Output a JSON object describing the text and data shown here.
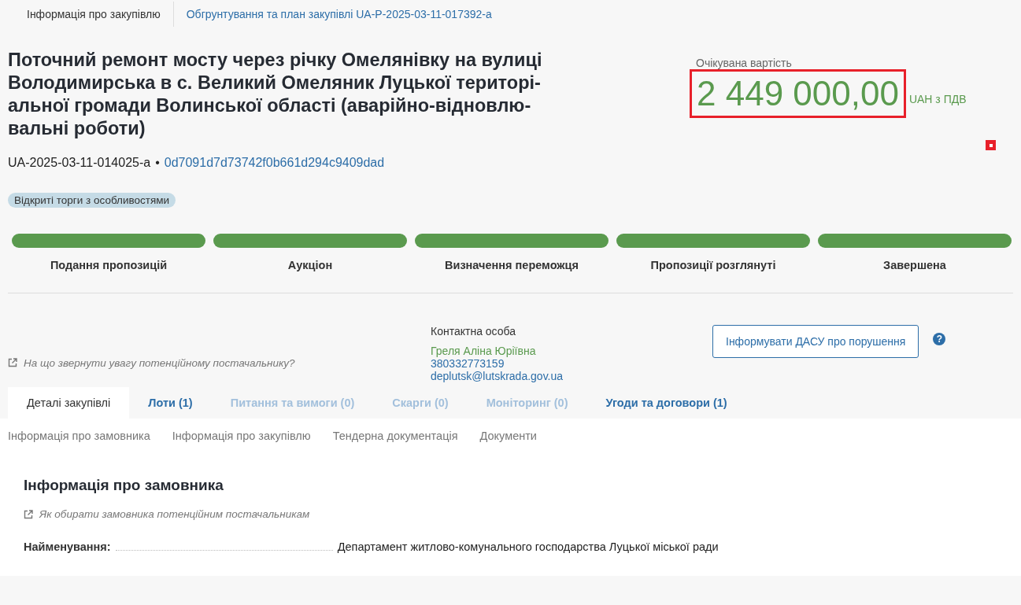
{
  "top_tabs": [
    {
      "label": "Інформація про закупівлю",
      "selected": true
    },
    {
      "label": "Обгрунтування та план закупівлі UA-P-2025-03-11-017392-a",
      "selected": false
    }
  ],
  "title_lines": [
    "Поточний ремонт мосту через річку Омелянівку на вулиці",
    "Володимирська в с. Великий Омеляник Луцької територі-",
    "альної громади Волинської області (аварійно-відновлю-",
    "вальні роботи)"
  ],
  "tender_id": "UA-2025-03-11-014025-a",
  "separator": "•",
  "hash": "0d7091d7d73742f0b661d294c9409dad",
  "procedure_badge": "Відкриті торги з особливостями",
  "expected_value": {
    "label": "Очікувана вартість",
    "amount": "2 449 000,00",
    "currency": "UAH з ПДВ"
  },
  "stages": [
    {
      "label": "Подання пропозицій",
      "done": true
    },
    {
      "label": "Аукціон",
      "done": true
    },
    {
      "label": "Визначення переможця",
      "done": true
    },
    {
      "label": "Пропозиції розглянуті",
      "done": true
    },
    {
      "label": "Завершена",
      "done": true
    }
  ],
  "supplier_hint": "На що звернути увагу потенційному постачальнику?",
  "contact": {
    "heading": "Контактна особа",
    "name": "Греля Аліна Юріївна",
    "phone": "380332773159",
    "email": "deplutsk@lutskrada.gov.ua"
  },
  "report_button": "Інформувати ДАСУ про порушення",
  "help_icon": "?",
  "main_tabs": [
    {
      "label": "Деталі закупівлі",
      "selected": true,
      "disabled": false
    },
    {
      "label": "Лоти (1)",
      "selected": false,
      "disabled": false
    },
    {
      "label": "Питання та вимоги (0)",
      "selected": false,
      "disabled": true
    },
    {
      "label": "Скарги (0)",
      "selected": false,
      "disabled": true
    },
    {
      "label": "Моніторинг (0)",
      "selected": false,
      "disabled": true
    },
    {
      "label": "Угоди та договори (1)",
      "selected": false,
      "disabled": false
    }
  ],
  "sub_nav": [
    "Інформація про замовника",
    "Інформація про закупівлю",
    "Тендерна документація",
    "Документи"
  ],
  "section": {
    "title": "Інформація про замовника",
    "hint": "Як обирати замовника потенційним постачальникам",
    "fields": [
      {
        "label": "Найменування:",
        "value": "Департамент житлово-комунального господарства Луцької міської ради"
      }
    ]
  }
}
